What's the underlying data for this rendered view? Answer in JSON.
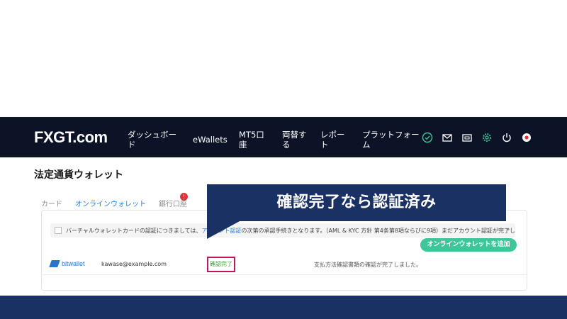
{
  "navbar": {
    "logo": "FXGT.com",
    "items": [
      "ダッシュボー\nド",
      "eWallets",
      "MT5口\n座",
      "両替す\nる",
      "レポー\nト",
      "プラットフォー\nム"
    ],
    "icons": [
      "check-circle-icon",
      "mail-icon",
      "wallet-card-icon",
      "gear-icon",
      "power-icon",
      "flag-icon"
    ]
  },
  "page": {
    "title": "法定通貨ウォレット",
    "tabs": [
      "カード",
      "オンラインウォレット",
      "銀行口座"
    ],
    "tab_badge": "!"
  },
  "notice": {
    "text_before": "バーチャルウォレットカードの認証につきましては、",
    "link": "アカウント認証",
    "text_after": "の次第の承認手続きとなります。（AML & KYC 方針 第4条第8項ならびに9項）まだアカウント認証が完了し"
  },
  "add_button": "オンラインウォレットを追加",
  "wallet_row": {
    "provider": "bitwallet",
    "email": "kawase@example.com",
    "status": "確認完了",
    "description": "支払方法確認書類の確認が完了しました。"
  },
  "callout": "確認完了なら認証済み",
  "colors": {
    "navbar_bg": "#0c1326",
    "callout_bg": "#1a3164",
    "accent_green": "#3fc59a",
    "link_blue": "#2a7fd9",
    "highlight_border": "#c2185b"
  }
}
